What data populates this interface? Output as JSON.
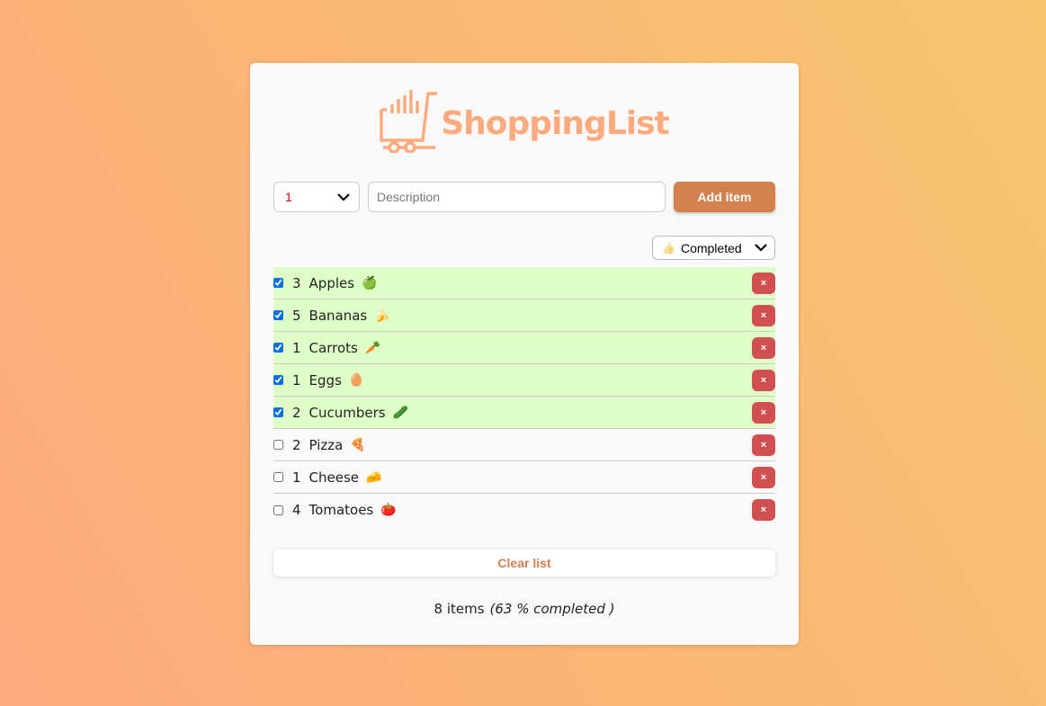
{
  "app": {
    "title": "ShoppingList",
    "brand_color": "#fdab7e",
    "icon": "shopping-cart-icon"
  },
  "form": {
    "quantity": "1",
    "description_placeholder": "Description",
    "description_value": "",
    "add_label": "Add item"
  },
  "filter": {
    "icon": "👍",
    "selected": "Completed"
  },
  "items": [
    {
      "qty": "3",
      "name": "Apples",
      "emoji": "🍏",
      "done": true
    },
    {
      "qty": "5",
      "name": "Bananas",
      "emoji": "🍌",
      "done": true
    },
    {
      "qty": "1",
      "name": "Carrots",
      "emoji": "🥕",
      "done": true
    },
    {
      "qty": "1",
      "name": "Eggs",
      "emoji": "🥚",
      "done": true
    },
    {
      "qty": "2",
      "name": "Cucumbers",
      "emoji": "🥒",
      "done": true
    },
    {
      "qty": "2",
      "name": "Pizza",
      "emoji": "🍕",
      "done": false
    },
    {
      "qty": "1",
      "name": "Cheese",
      "emoji": "🧀",
      "done": false
    },
    {
      "qty": "4",
      "name": "Tomatoes",
      "emoji": "🍅",
      "done": false
    }
  ],
  "delete_label": "×",
  "clear_label": "Clear list",
  "summary": {
    "count": "8 items",
    "completed": "(63 % completed )"
  },
  "colors": {
    "done_row": "#dfffc8",
    "delete": "#d05050",
    "accent": "#d2814f"
  }
}
